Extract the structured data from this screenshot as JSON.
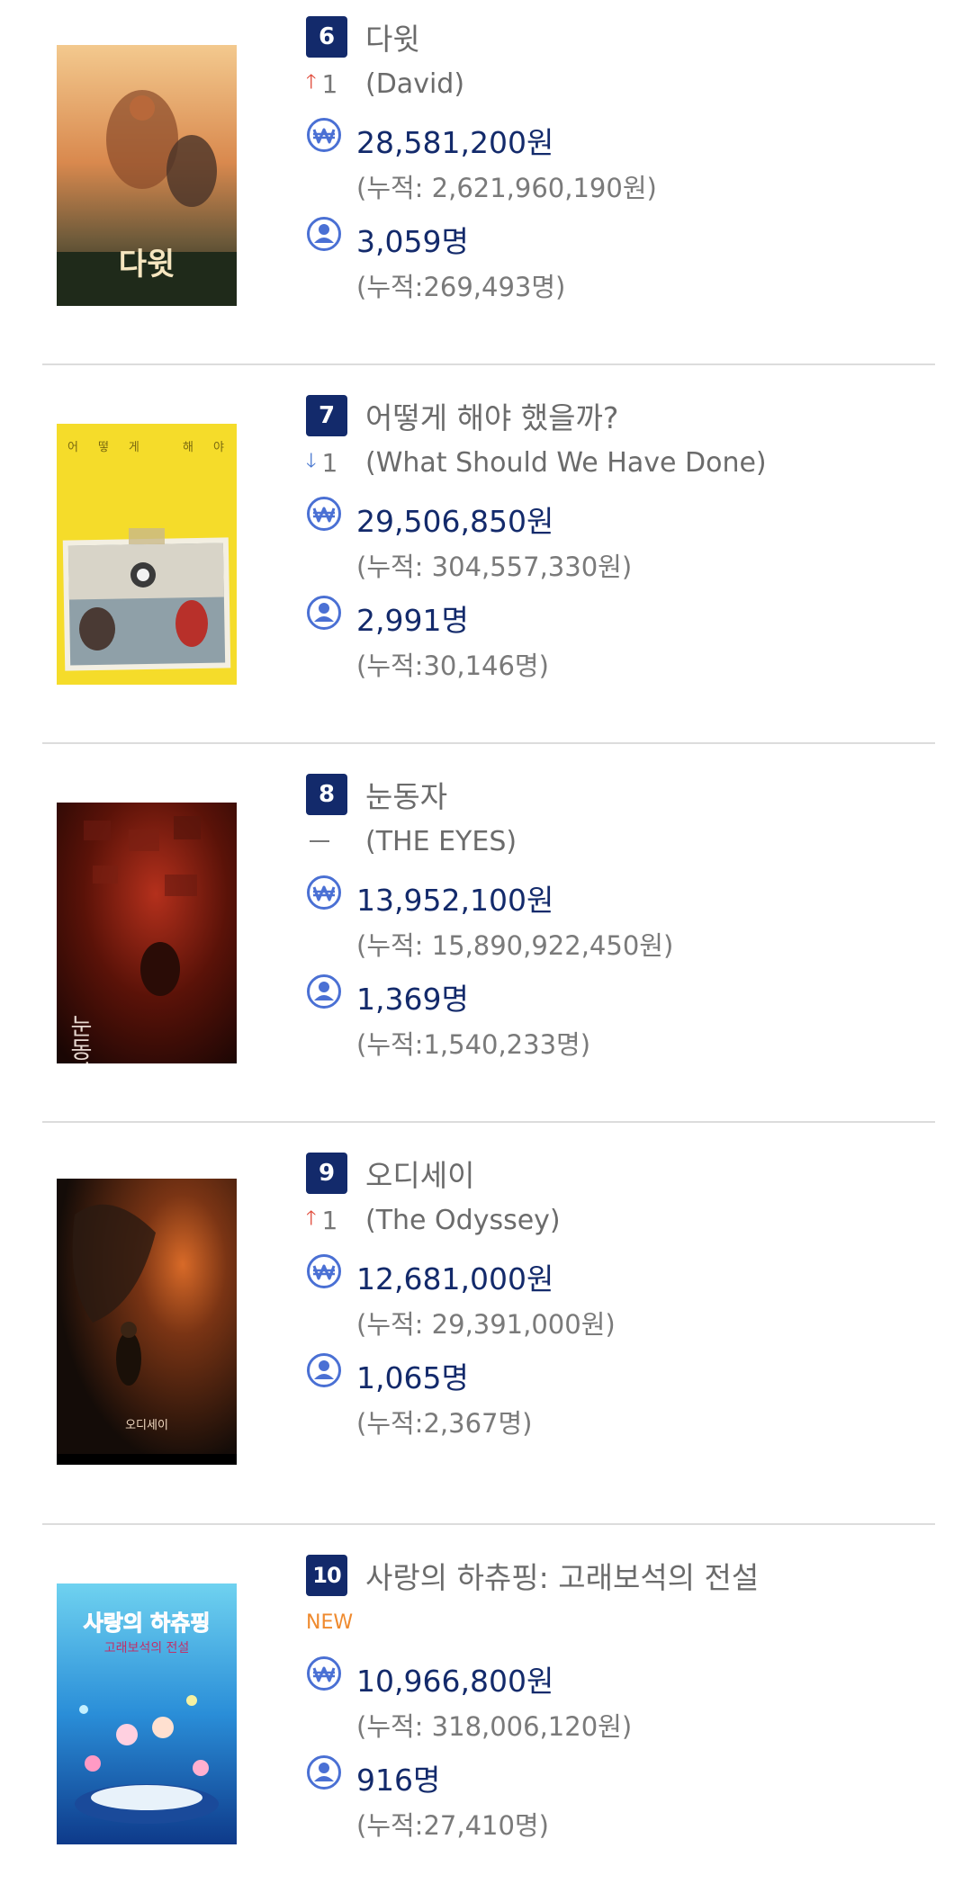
{
  "movies": [
    {
      "rank": "6",
      "title_ko": "다윗",
      "change": {
        "direction": "up",
        "amount": "1"
      },
      "title_en": "(David)",
      "sales": "28,581,200원",
      "sales_cum": "(누적: 2,621,960,190원)",
      "audience": "3,059명",
      "audience_cum": "(누적:269,493명)",
      "poster_text": "다윗",
      "poster_theme": "warm-sunset"
    },
    {
      "rank": "7",
      "title_ko": "어떻게 해야 했을까?",
      "change": {
        "direction": "down",
        "amount": "1"
      },
      "title_en": "(What Should We Have Done)",
      "sales": "29,506,850원",
      "sales_cum": "(누적: 304,557,330원)",
      "audience": "2,991명",
      "audience_cum": "(누적:30,146명)",
      "poster_text": "어떻게 해야 했을까?",
      "poster_theme": "yellow-photo"
    },
    {
      "rank": "8",
      "title_ko": "눈동자",
      "change": {
        "direction": "same",
        "amount": ""
      },
      "title_en": "(THE EYES)",
      "sales": "13,952,100원",
      "sales_cum": "(누적: 15,890,922,450원)",
      "audience": "1,369명",
      "audience_cum": "(누적:1,540,233명)",
      "poster_text": "눈동자",
      "poster_theme": "dark-red"
    },
    {
      "rank": "9",
      "title_ko": "오디세이",
      "change": {
        "direction": "up",
        "amount": "1"
      },
      "title_en": "(The Odyssey)",
      "sales": "12,681,000원",
      "sales_cum": "(누적: 29,391,000원)",
      "audience": "1,065명",
      "audience_cum": "(누적:2,367명)",
      "poster_text": "오디세이",
      "poster_theme": "dark-fire"
    },
    {
      "rank": "10",
      "title_ko": "사랑의 하츄핑: 고래보석의 전설",
      "change": {
        "direction": "new",
        "amount": "NEW"
      },
      "title_en": "",
      "sales": "10,966,800원",
      "sales_cum": "(누적: 318,006,120원)",
      "audience": "916명",
      "audience_cum": "(누적:27,410명)",
      "poster_text": "사랑의 하츄핑",
      "poster_subtext": "고래보석의 전설",
      "poster_theme": "underwater-blue"
    }
  ],
  "icons": {
    "sales": "won-coin-icon",
    "audience": "person-circle-icon",
    "up": "arrow-up-icon",
    "down": "arrow-down-icon",
    "same": "dash-icon"
  },
  "colors": {
    "rank_badge": "#132a6b",
    "value_text": "#132a6b",
    "up_arrow": "#e04a3a",
    "down_arrow": "#4a78d0",
    "new_tag": "#ef8a2e",
    "icon_fill": "#4a70d4"
  }
}
